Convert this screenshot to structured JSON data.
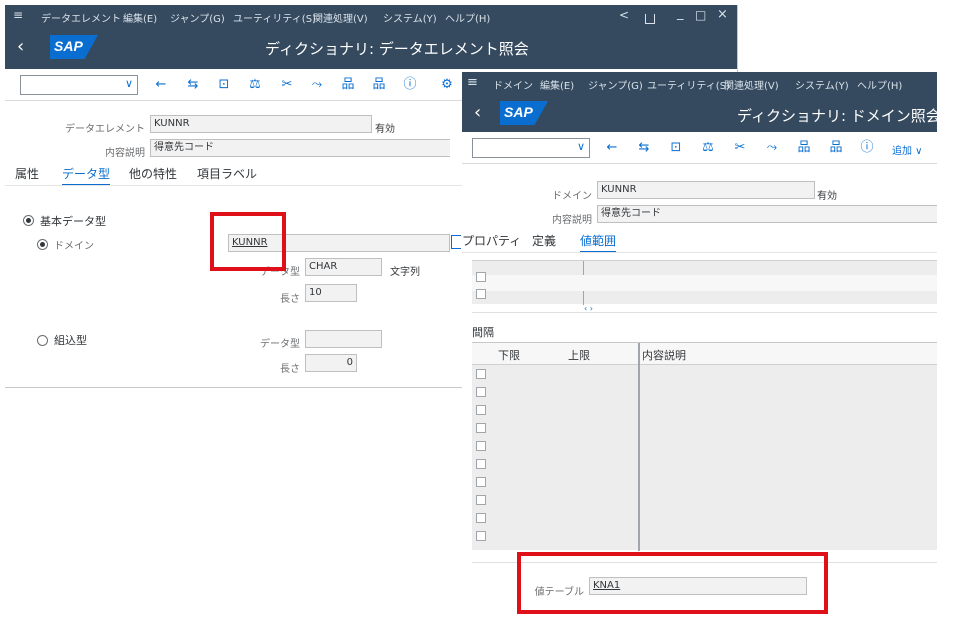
{
  "win1": {
    "menu": [
      "データエレメント",
      "編集(E)",
      "ジャンプ(G)",
      "ユーティリティ(S)",
      "関連処理(V)",
      "システム(Y)",
      "ヘルプ(H)"
    ],
    "controls": {
      "back": "<",
      "lock": "🔓",
      "min": "_",
      "max": "□",
      "close": "×"
    },
    "logo": "SAP",
    "title": "ディクショナリ: データエレメント照会",
    "toolbar_icons": [
      "←",
      "⇆",
      "⊡",
      "⚖",
      "✂",
      "⤳",
      "品",
      "品",
      "ⓘ",
      "⚙"
    ],
    "data_element_label": "データエレメント",
    "data_element_value": "KUNNR",
    "status": "有効",
    "short_desc_label": "内容説明",
    "short_desc_value": "得意先コード",
    "tabs": [
      "属性",
      "データ型",
      "他の特性",
      "項目ラベル"
    ],
    "elementary_type": "基本データ型",
    "domain_label": "ドメイン",
    "domain_value": "KUNNR",
    "data_type_label": "データ型",
    "data_type_value": "CHAR",
    "data_type_desc": "文字列",
    "length_label": "長さ",
    "length_value": "10",
    "ref_type": "組込型",
    "ref_data_type_label": "データ型",
    "ref_data_type_value": "",
    "ref_length_label": "長さ",
    "ref_length_value": "0"
  },
  "win2": {
    "menu": [
      "ドメイン",
      "編集(E)",
      "ジャンプ(G)",
      "ユーティリティ(S)",
      "関連処理(V)",
      "システム(Y)",
      "ヘルプ(H)"
    ],
    "menu_icon": "≡",
    "logo": "SAP",
    "title": "ディクショナリ: ドメイン照会",
    "toolbar_icons": [
      "←",
      "⇆",
      "⊡",
      "⚖",
      "✂",
      "⤳",
      "品",
      "品",
      "ⓘ"
    ],
    "add_label": "追加 ∨",
    "domain_label": "ドメイン",
    "domain_value": "KUNNR",
    "status": "有効",
    "short_desc_label": "内容説明",
    "short_desc_value": "得意先コード",
    "tabs": [
      "プロパティ",
      "定義",
      "値範囲"
    ],
    "intervals_label": "間隔",
    "columns": [
      "下限",
      "上限",
      "内容説明"
    ],
    "scroll_marker": "‹ ›",
    "value_table_label": "値テーブル",
    "value_table_value": "KNA1"
  },
  "colors": {
    "shell": "#354a5f",
    "accent": "#0a6ed1",
    "highlight": "#e0101a"
  }
}
